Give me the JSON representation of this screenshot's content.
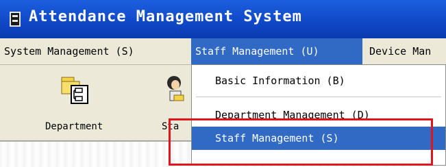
{
  "window": {
    "title": "Attendance Management System",
    "app_icon": "app-icon"
  },
  "menubar": {
    "items": [
      {
        "label": "System Management (S)"
      },
      {
        "label": "Staff Management (U)"
      },
      {
        "label": "Device Man"
      }
    ],
    "active_index": 1
  },
  "toolbar": {
    "buttons": [
      {
        "label": "Department",
        "icon": "department-icon"
      },
      {
        "label": "Sta",
        "icon": "staff-icon"
      }
    ]
  },
  "dropdown": {
    "items": [
      {
        "label": "Basic Information (B)"
      },
      {
        "label": "Department Management (D)"
      },
      {
        "label": "Staff Management (S)"
      }
    ],
    "highlighted_index": 2
  },
  "colors": {
    "titlebar": "#1049c8",
    "menu_highlight": "#316ac5",
    "annotation_box": "#e0141a"
  }
}
